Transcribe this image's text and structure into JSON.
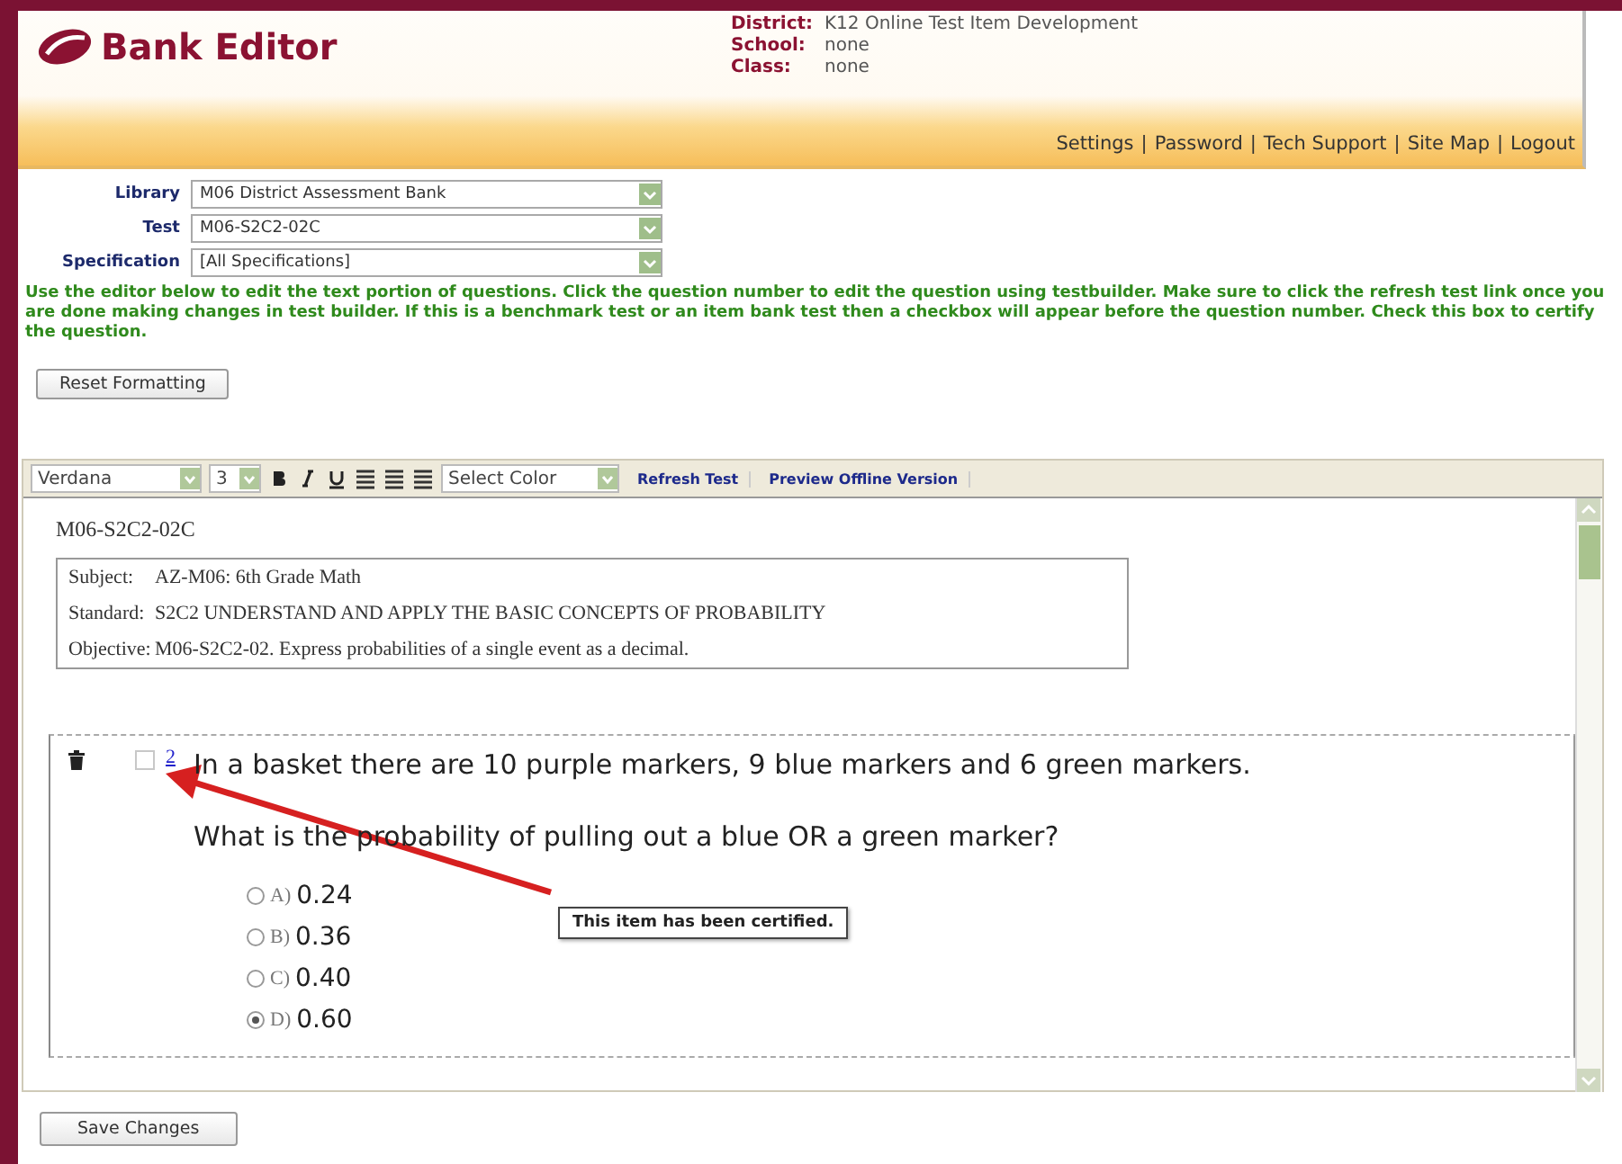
{
  "header": {
    "title": "Bank Editor",
    "info": [
      {
        "label": "District:",
        "value": "K12 Online Test Item Development"
      },
      {
        "label": "School:",
        "value": "none"
      },
      {
        "label": "Class:",
        "value": "none"
      }
    ],
    "links": [
      "Settings",
      "Password",
      "Tech Support",
      "Site Map",
      "Logout"
    ],
    "separator": "|"
  },
  "filters": [
    {
      "label": "Library",
      "value": "M06 District Assessment Bank"
    },
    {
      "label": "Test",
      "value": "M06-S2C2-02C"
    },
    {
      "label": "Specification",
      "value": "[All Specifications]"
    }
  ],
  "instructions": "Use the editor below to edit the text portion of questions. Click the question number to edit the question using testbuilder. Make sure to click the refresh test link once you are done making changes in test builder. If this is a benchmark test or an item bank test then a checkbox will appear before the question number. Check this box to certify the question.",
  "reset_button": "Reset Formatting",
  "toolbar": {
    "font": "Verdana",
    "size": "3",
    "color_picker": "Select Color",
    "links": [
      "Refresh Test",
      "Preview Offline Version"
    ]
  },
  "document": {
    "code": "M06-S2C2-02C",
    "meta": [
      {
        "label": "Subject:",
        "value": "AZ-M06: 6th Grade Math"
      },
      {
        "label": "Standard:",
        "value": "S2C2 UNDERSTAND AND APPLY THE BASIC CONCEPTS OF PROBABILITY"
      },
      {
        "label": "Objective:",
        "value": "M06-S2C2-02. Express probabilities of a single event as a decimal."
      }
    ],
    "question": {
      "checked": false,
      "number": "2",
      "text": [
        "In a basket there are 10 purple markers, 9 blue markers and 6 green markers.",
        "What is the probability of pulling out a blue OR a green marker?"
      ],
      "choices": [
        {
          "letter": "A)",
          "value": "0.24",
          "selected": false
        },
        {
          "letter": "B)",
          "value": "0.36",
          "selected": false
        },
        {
          "letter": "C)",
          "value": "0.40",
          "selected": false
        },
        {
          "letter": "D)",
          "value": "0.60",
          "selected": true
        }
      ]
    }
  },
  "callout": "This item has been certified.",
  "save_button": "Save Changes"
}
